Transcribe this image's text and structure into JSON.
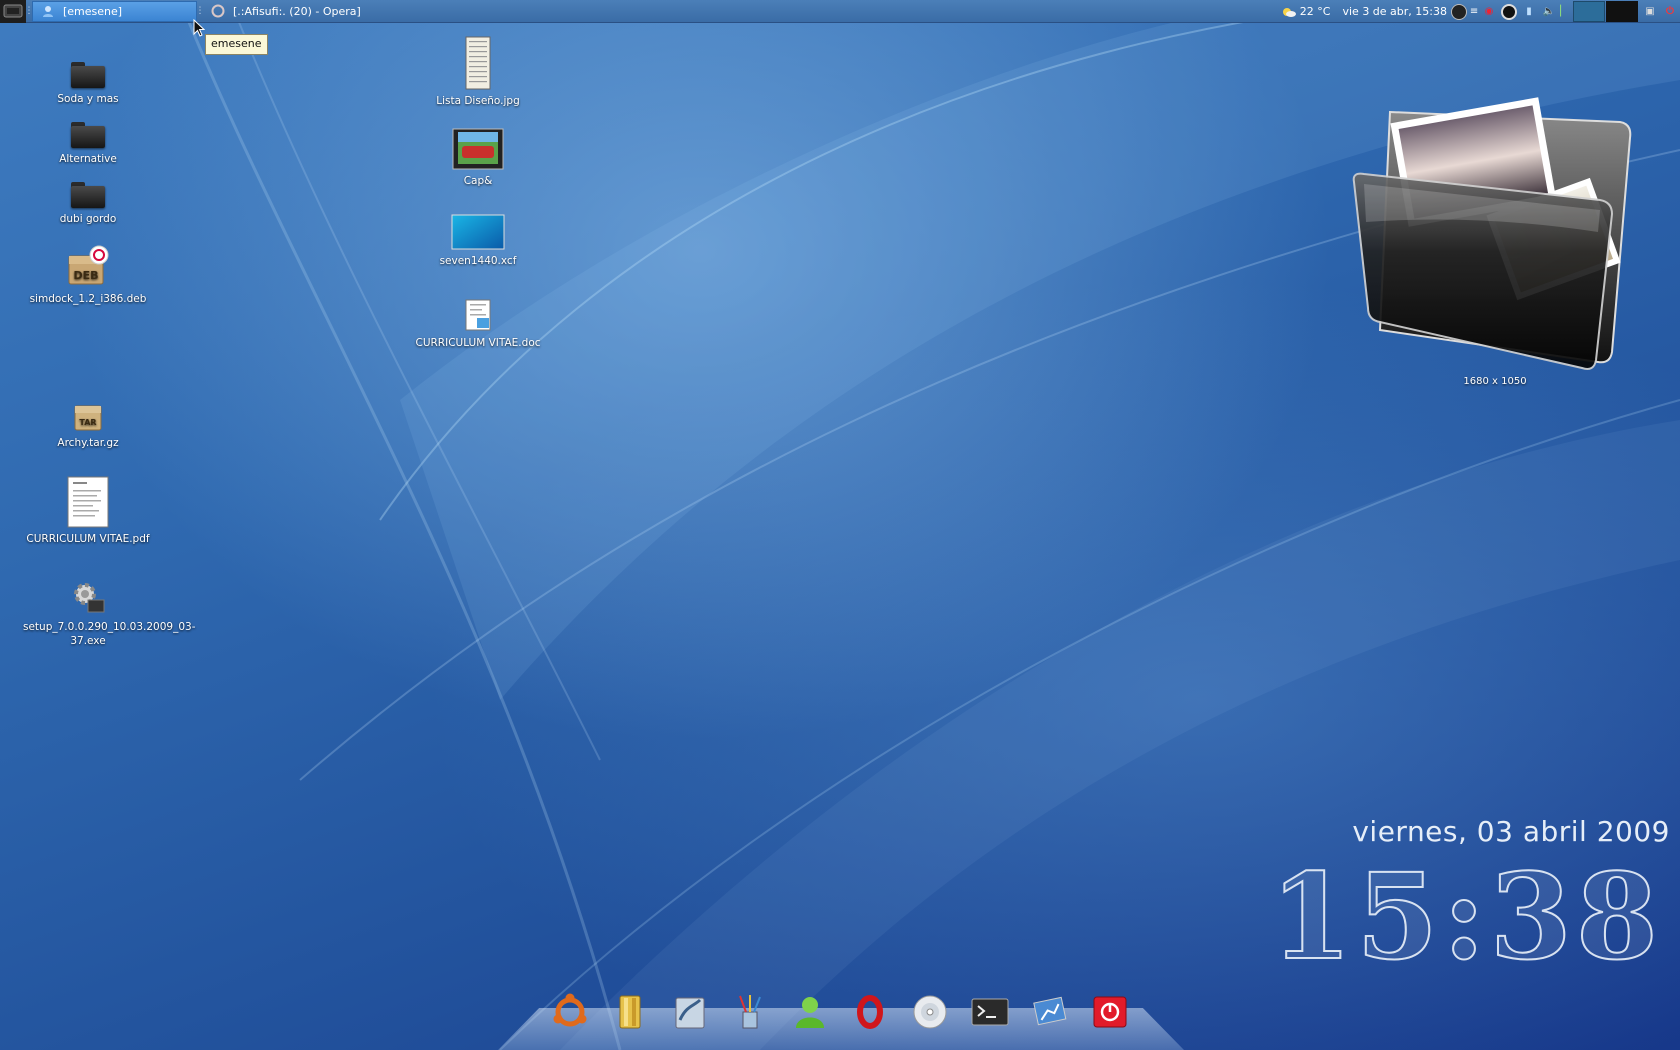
{
  "taskbar": {
    "tasks": [
      {
        "label": "[emesene]",
        "active": true
      },
      {
        "label": "[.:Afisufi:. (20) - Opera]",
        "active": false
      }
    ],
    "weather": "22 °C",
    "datetime": "vie  3 de abr, 15:38"
  },
  "tooltip": {
    "text": "emesene"
  },
  "desktop_icons": [
    {
      "label": "Soda y mas",
      "icon": "folder-icon"
    },
    {
      "label": "Alternative",
      "icon": "folder-icon"
    },
    {
      "label": "dubi gordo",
      "icon": "folder-icon"
    },
    {
      "label": "simdock_1.2_i386.deb",
      "icon": "deb-package-icon"
    },
    {
      "label": "Archy.tar.gz",
      "icon": "tar-archive-icon"
    },
    {
      "label": "CURRICULUM VITAE.pdf",
      "icon": "pdf-document-icon"
    },
    {
      "label": "setup_7.0.0.290_10.03.2009_03-37.exe",
      "icon": "exe-gear-icon"
    },
    {
      "label": "Lista Diseño.jpg",
      "icon": "image-file-icon"
    },
    {
      "label": "Cap&",
      "icon": "video-file-icon"
    },
    {
      "label": "seven1440.xcf",
      "icon": "xcf-image-icon"
    },
    {
      "label": "CURRICULUM VITAE.doc",
      "icon": "doc-document-icon"
    }
  ],
  "photo_widget": {
    "resolution": "1680 x 1050"
  },
  "clock": {
    "date": "viernes, 03 abril 2009",
    "time": "15:38"
  },
  "dock": {
    "items": [
      "ubuntu-icon",
      "file-manager-icon",
      "openoffice-icon",
      "graphics-brushes-icon",
      "messenger-user-icon",
      "opera-icon",
      "cd-burner-icon",
      "terminal-icon",
      "desktop-preview-icon",
      "power-icon"
    ]
  },
  "colors": {
    "accent": "#3b84d2",
    "panel": "#3a6ca6",
    "desktop": "#2f69b0"
  }
}
